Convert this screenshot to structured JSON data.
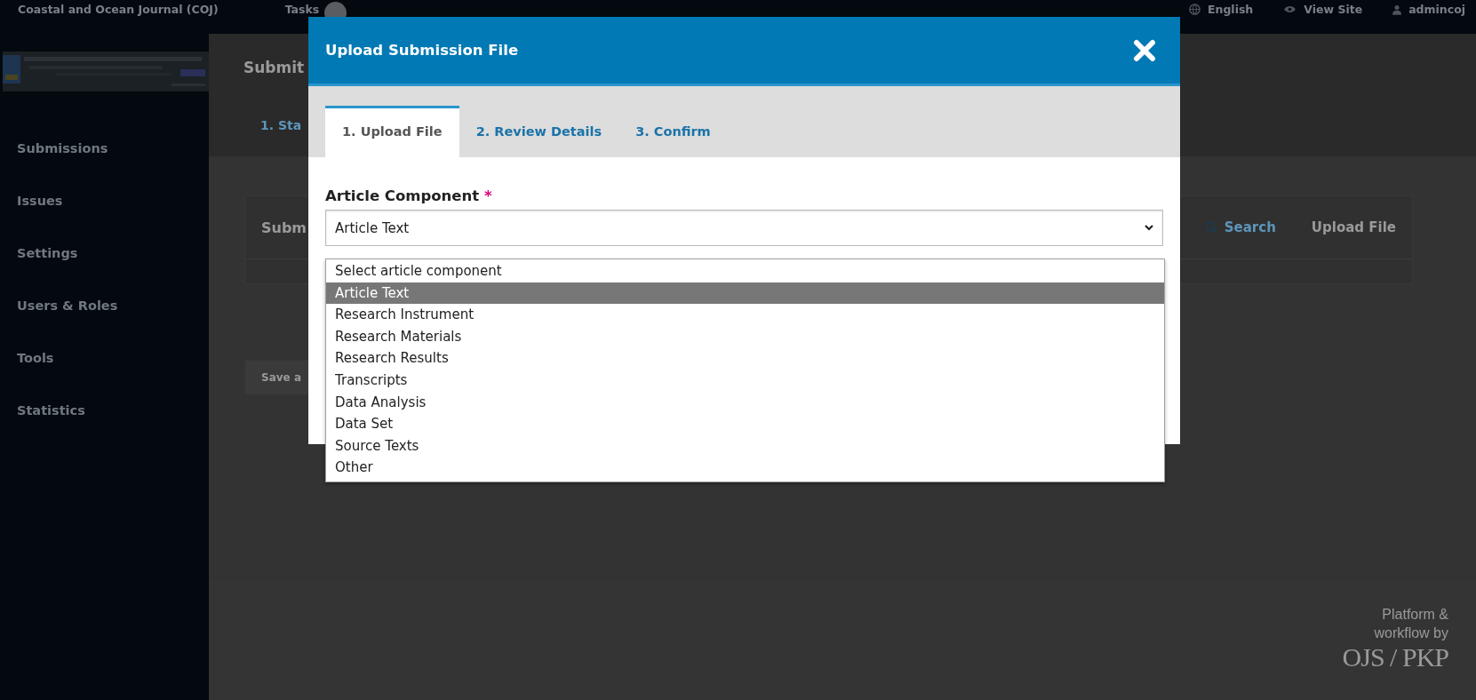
{
  "top_bar": {
    "journal_title": "Coastal and Ocean Journal (COJ)",
    "tasks": "Tasks",
    "language": "English",
    "view_site": "View Site",
    "user": "admincoj"
  },
  "sidebar": {
    "items": [
      {
        "label": "Submissions"
      },
      {
        "label": "Issues"
      },
      {
        "label": "Settings"
      },
      {
        "label": "Users & Roles"
      },
      {
        "label": "Tools"
      },
      {
        "label": "Statistics"
      }
    ]
  },
  "page": {
    "title": "Submit",
    "tabs": [
      {
        "label": "1. Sta"
      }
    ],
    "panel": {
      "title": "Subm",
      "search": "Search",
      "upload": "Upload File"
    },
    "save_button": "Save a"
  },
  "footer": {
    "text": "Platform & workflow by",
    "logo": "OJS / PKP"
  },
  "modal": {
    "title": "Upload Submission File",
    "tabs": [
      {
        "label": "1. Upload File",
        "selected": true
      },
      {
        "label": "2. Review Details",
        "selected": false
      },
      {
        "label": "3. Confirm",
        "selected": false
      }
    ],
    "field": {
      "label": "Article Component",
      "required": true,
      "required_mark": "*",
      "value": "Article Text",
      "expanded": true,
      "options": [
        {
          "label": "Select article component",
          "selected": false
        },
        {
          "label": "Article Text",
          "selected": true
        },
        {
          "label": "Research Instrument",
          "selected": false
        },
        {
          "label": "Research Materials",
          "selected": false
        },
        {
          "label": "Research Results",
          "selected": false
        },
        {
          "label": "Transcripts",
          "selected": false
        },
        {
          "label": "Data Analysis",
          "selected": false
        },
        {
          "label": "Data Set",
          "selected": false
        },
        {
          "label": "Source Texts",
          "selected": false
        },
        {
          "label": "Other",
          "selected": false
        }
      ]
    }
  }
}
